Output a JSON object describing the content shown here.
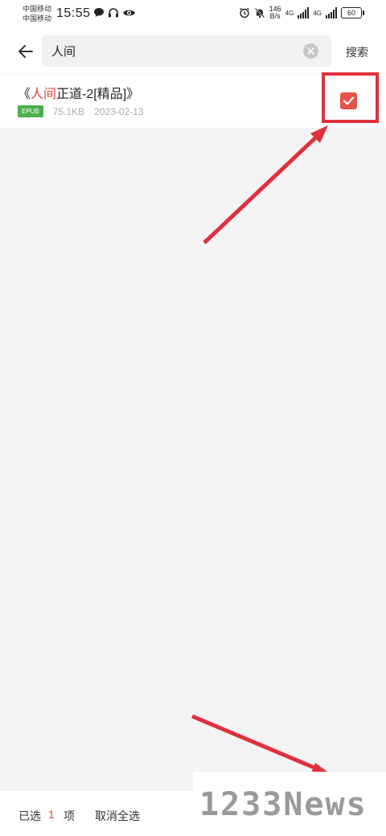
{
  "status_bar": {
    "carrier_1": "中国移动",
    "carrier_2": "中国移动",
    "time": "15:55",
    "net_speed_value": "146",
    "net_speed_unit": "B/s",
    "net_type_1": "4G",
    "net_type_2": "4G",
    "battery": "60"
  },
  "search": {
    "value": "人间",
    "button_label": "搜索"
  },
  "results": [
    {
      "title_prefix": "《",
      "title_highlight": "人间",
      "title_suffix": "正道-2[精品]》",
      "format": "EPUB",
      "size": "75.1KB",
      "date": "2023-02-13",
      "checked": true
    }
  ],
  "bottom_bar": {
    "selected_label": "已选",
    "selected_count": "1",
    "selected_unit": "项",
    "deselect_all_label": "取消全选"
  },
  "watermark": {
    "text": "1233News"
  },
  "colors": {
    "accent": "#e0463c",
    "checkbox": "#e8524a",
    "annotation": "#e0303c",
    "badge": "#4caf50"
  }
}
